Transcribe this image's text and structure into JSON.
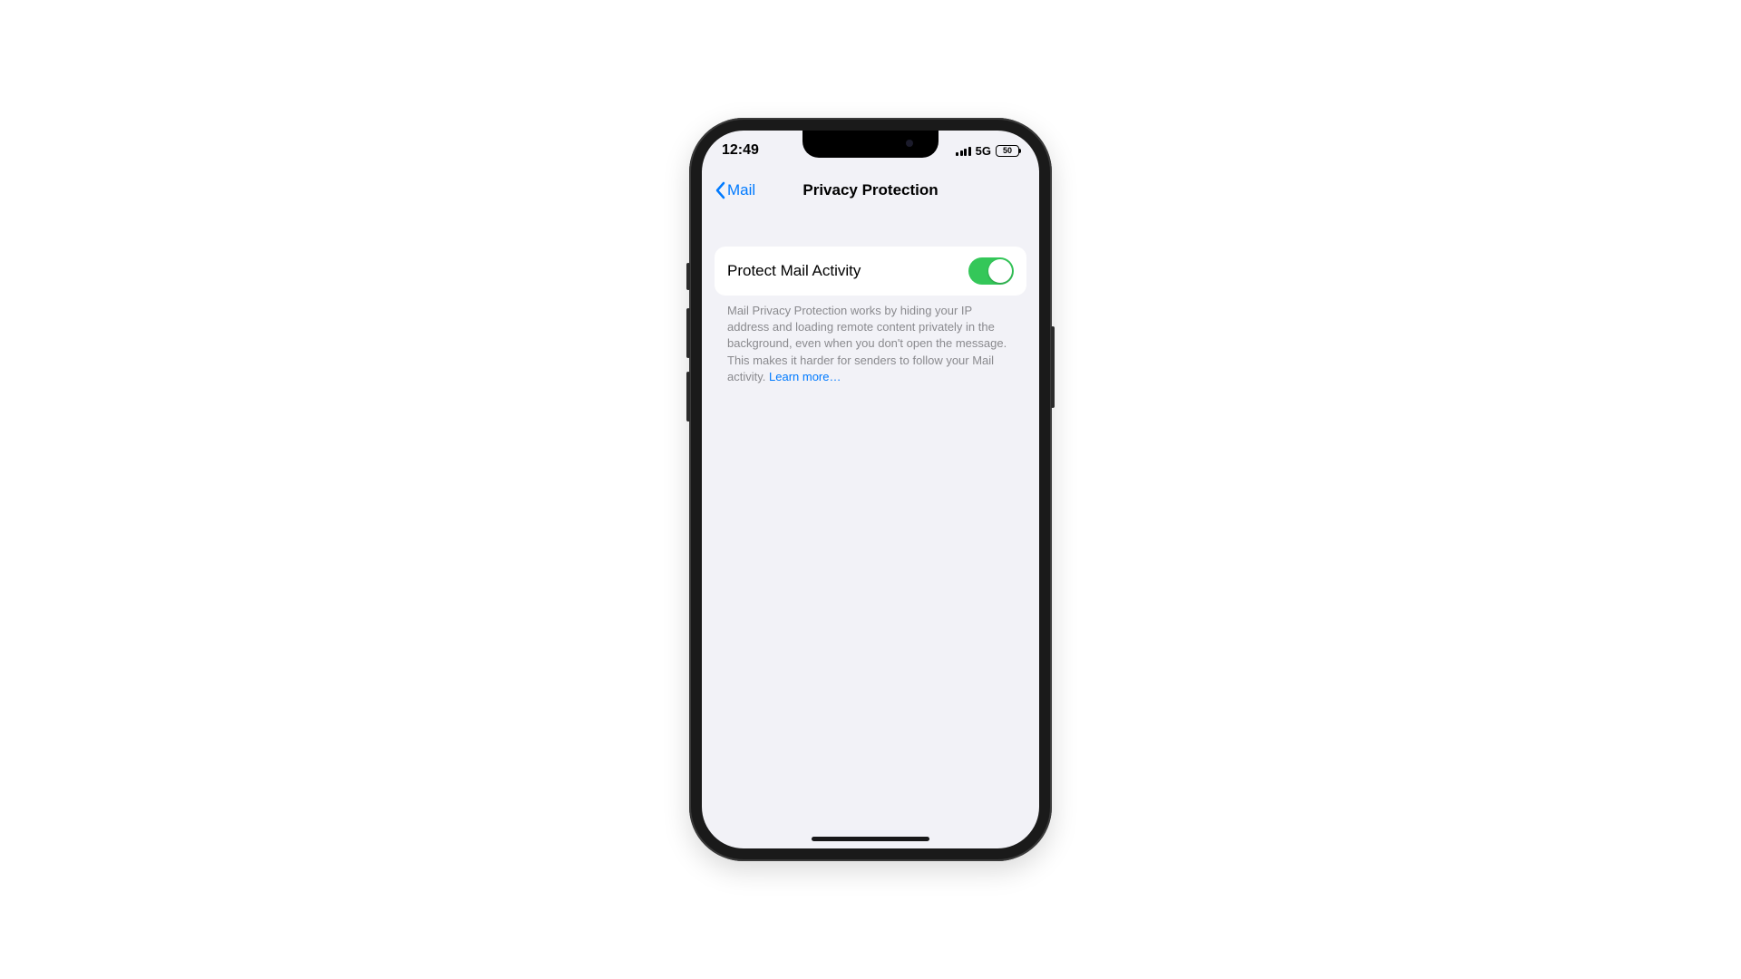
{
  "status": {
    "time": "12:49",
    "network": "5G",
    "battery_text": "50"
  },
  "nav": {
    "back_label": "Mail",
    "title": "Privacy Protection"
  },
  "settings": {
    "protect_label": "Protect Mail Activity",
    "protect_on": true
  },
  "footer": {
    "text": "Mail Privacy Protection works by hiding your IP address and loading remote content privately in the background, even when you don't open the message. This makes it harder for senders to follow your Mail activity. ",
    "link": "Learn more…"
  },
  "colors": {
    "accent": "#007aff",
    "switch_on": "#34c759",
    "bg": "#f2f2f7"
  }
}
